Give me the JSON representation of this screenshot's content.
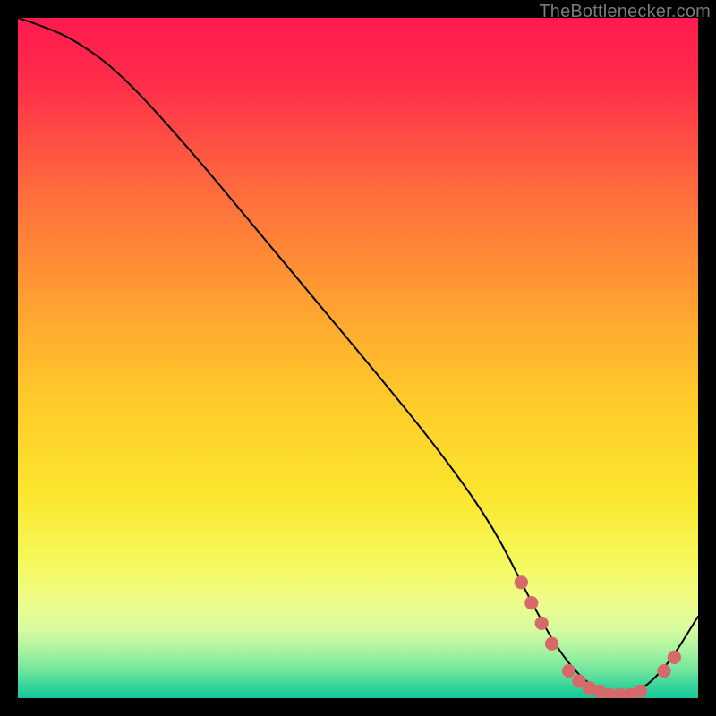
{
  "attribution": "TheBottlenecker.com",
  "chart_data": {
    "type": "line",
    "title": "",
    "xlabel": "",
    "ylabel": "",
    "xlim": [
      0,
      100
    ],
    "ylim": [
      0,
      100
    ],
    "series": [
      {
        "name": "curve",
        "color": "#000000",
        "x": [
          0,
          3,
          8,
          15,
          25,
          35,
          45,
          55,
          63,
          70,
          75,
          80,
          85,
          90,
          95,
          100
        ],
        "y": [
          100,
          99,
          97,
          92,
          81,
          69,
          57,
          45,
          35,
          25,
          15,
          6,
          1,
          0,
          4,
          12
        ]
      }
    ],
    "markers": {
      "name": "dots",
      "color": "#d66a6a",
      "points": [
        {
          "x": 74,
          "y": 17
        },
        {
          "x": 75.5,
          "y": 14
        },
        {
          "x": 77,
          "y": 11
        },
        {
          "x": 78.5,
          "y": 8
        },
        {
          "x": 81,
          "y": 4
        },
        {
          "x": 82.5,
          "y": 2.5
        },
        {
          "x": 84,
          "y": 1.5
        },
        {
          "x": 85.5,
          "y": 1
        },
        {
          "x": 87,
          "y": 0.5
        },
        {
          "x": 88.5,
          "y": 0.5
        },
        {
          "x": 90,
          "y": 0.5
        },
        {
          "x": 91.5,
          "y": 1
        },
        {
          "x": 95,
          "y": 4
        },
        {
          "x": 96.5,
          "y": 6
        }
      ]
    },
    "background_gradient": {
      "stops": [
        {
          "offset": 0.0,
          "color": "#ff1a4e"
        },
        {
          "offset": 0.1,
          "color": "#ff2f4a"
        },
        {
          "offset": 0.25,
          "color": "#ff6a3d"
        },
        {
          "offset": 0.4,
          "color": "#ff9a33"
        },
        {
          "offset": 0.55,
          "color": "#ffc82a"
        },
        {
          "offset": 0.7,
          "color": "#fbe62d"
        },
        {
          "offset": 0.8,
          "color": "#f6f95b"
        },
        {
          "offset": 0.86,
          "color": "#eefc8c"
        },
        {
          "offset": 0.9,
          "color": "#d6fba0"
        },
        {
          "offset": 0.93,
          "color": "#a8f3a0"
        },
        {
          "offset": 0.96,
          "color": "#6fe49d"
        },
        {
          "offset": 0.985,
          "color": "#2fd29a"
        },
        {
          "offset": 1.0,
          "color": "#17c79a"
        }
      ]
    }
  }
}
